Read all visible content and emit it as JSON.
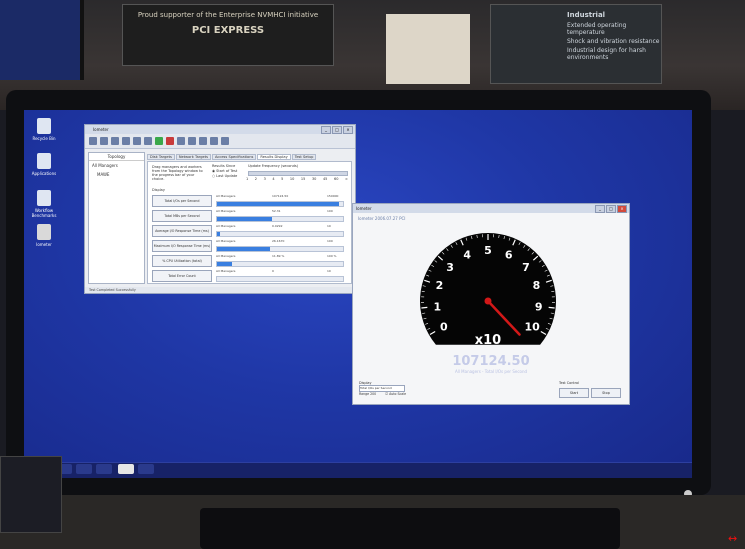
{
  "booth": {
    "poster_left_top": "Proud supporter of the Enterprise NVMHCI initiative",
    "poster_left_logo": "PCI EXPRESS",
    "poster_right_title": "Industrial",
    "poster_right_lines": [
      "Extended operating temperature",
      "Shock and vibration resistance",
      "Industrial design for harsh environments"
    ]
  },
  "desktop_icons": [
    {
      "label": "Recycle Bin"
    },
    {
      "label": "Applications"
    },
    {
      "label": "Workflow Benchmarks"
    },
    {
      "label": "Iometer"
    }
  ],
  "app_window": {
    "title": "Iometer",
    "tree_header": "Topology",
    "tree_nodes": [
      "All Managers",
      "MAWE"
    ],
    "tabs": [
      "Disk Targets",
      "Network Targets",
      "Access Specifications",
      "Results Display",
      "Test Setup"
    ],
    "active_tab": "Results Display",
    "update_freq_label": "Update Frequency (seconds)",
    "results_since_label": "Results Since",
    "results_since_options": [
      "Start of Test",
      "Last Update"
    ],
    "freq_ticks": [
      "1",
      "2",
      "3",
      "4",
      "5",
      "10",
      "15",
      "30",
      "45",
      "60",
      "∞"
    ],
    "drag_hint": "Drag managers and workers from the Topology window to the progress bar of your choice.",
    "display_label": "Display",
    "rows": [
      {
        "button": "Total I/Os per Second",
        "worker": "All Managers",
        "value": "107124.50",
        "max": "150000",
        "fill": 0.97
      },
      {
        "button": "Total MBs per Second",
        "worker": "All Managers",
        "value": "52.31",
        "max": "100",
        "fill": 0.44
      },
      {
        "button": "Average I/O Response Time (ms)",
        "worker": "All Managers",
        "value": "0.0292",
        "max": "10",
        "fill": 0.02
      },
      {
        "button": "Maximum I/O Response Time (ms)",
        "worker": "All Managers",
        "value": "26.1670",
        "max": "100",
        "fill": 0.42
      },
      {
        "button": "% CPU Utilization (total)",
        "worker": "All Managers",
        "value": "11.89 %",
        "max": "100 %",
        "fill": 0.12
      },
      {
        "button": "Total Error Count",
        "worker": "All Managers",
        "value": "0",
        "max": "10",
        "fill": 0.0
      }
    ],
    "status": "Test Completed Successfully"
  },
  "gauge_window": {
    "title": "Iometer",
    "subtitle": "Iometer 2006.07.27 PCI",
    "dial_numbers": [
      "0",
      "1",
      "2",
      "3",
      "4",
      "5",
      "6",
      "7",
      "8",
      "9",
      "10"
    ],
    "multiplier": "x10",
    "needle_value": 10.7,
    "readout": "107124.50",
    "readout_unit": "All Managers - Total I/Os per Second",
    "select_label": "Display",
    "select_value": "Total I/Os per Second",
    "range_label": "Range 200",
    "auto_scale": "Auto Scale",
    "buttons_label": "Test Control",
    "button_ok": "Start",
    "button_cancel": "Stop"
  },
  "taskbar": {
    "buttons": 5
  },
  "colors": {
    "desktop": "#1f37a6",
    "needle": "#d21818",
    "dial_face": "#050505",
    "bar_fill": "#3a7fe0"
  }
}
